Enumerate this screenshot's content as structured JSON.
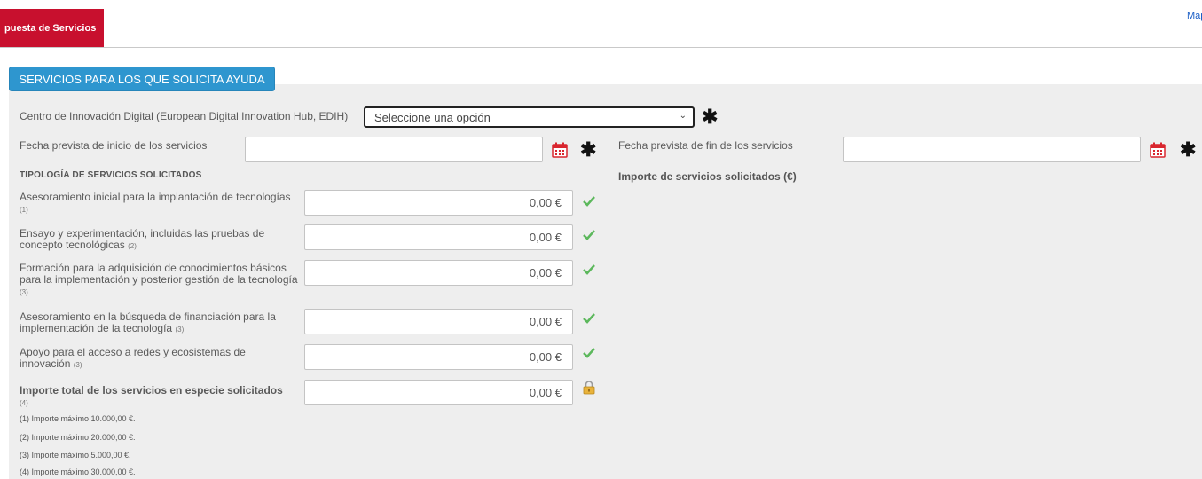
{
  "header": {
    "brand_tab": "puesta de Servicios",
    "top_link": "Map"
  },
  "section": {
    "title_button": "SERVICIOS PARA LOS QUE SOLICITA AYUDA"
  },
  "edih": {
    "label": "Centro de Innovación Digital (European Digital Innovation Hub, EDIH)",
    "select_value": "Seleccione una opción"
  },
  "dates": {
    "start_label": "Fecha prevista  de inicio de los servicios",
    "start_value": "",
    "end_label": "Fecha prevista de fin de los servicios",
    "end_value": ""
  },
  "services": {
    "typology_heading": "TIPOLOGÍA DE SERVICIOS SOLICITADOS",
    "amount_heading": "Importe de servicios solicitados (€)",
    "items": [
      {
        "label": "Asesoramiento inicial para la implantación de tecnologías",
        "note": "(1)",
        "value": "0,00 €"
      },
      {
        "label": "Ensayo y experimentación, incluidas las pruebas de concepto tecnológicas",
        "note": "(2)",
        "value": "0,00 €"
      },
      {
        "label": "Formación para la adquisición de conocimientos básicos para la implementación y posterior gestión de la tecnología",
        "note": "(3)",
        "value": "0,00 €"
      },
      {
        "label": "Asesoramiento en la búsqueda de financiación para la implementación de la tecnología",
        "note": "(3)",
        "value": "0,00 €"
      },
      {
        "label": "Apoyo para el acceso a redes y ecosistemas de innovación",
        "note": "(3)",
        "value": "0,00 €"
      }
    ],
    "total": {
      "label": "Importe total de los servicios en especie solicitados",
      "note": "(4)",
      "value": "0,00 €"
    }
  },
  "footnotes": [
    "(1) Importe máximo 10.000,00 €.",
    "(2) Importe máximo 20.000,00 €.",
    "(3) Importe máximo 5.000,00 €.",
    "(4) Importe máximo 30.000,00 €."
  ],
  "icons": {
    "required": "asterisk-icon",
    "calendar": "calendar-icon",
    "valid": "checkmark-icon",
    "locked": "lock-icon"
  },
  "colors": {
    "brand_red": "#c8102e",
    "section_blue": "#2e96cf",
    "panel_gray": "#eeeeee",
    "check_green": "#5cb85c",
    "calendar_red": "#d9262e"
  }
}
